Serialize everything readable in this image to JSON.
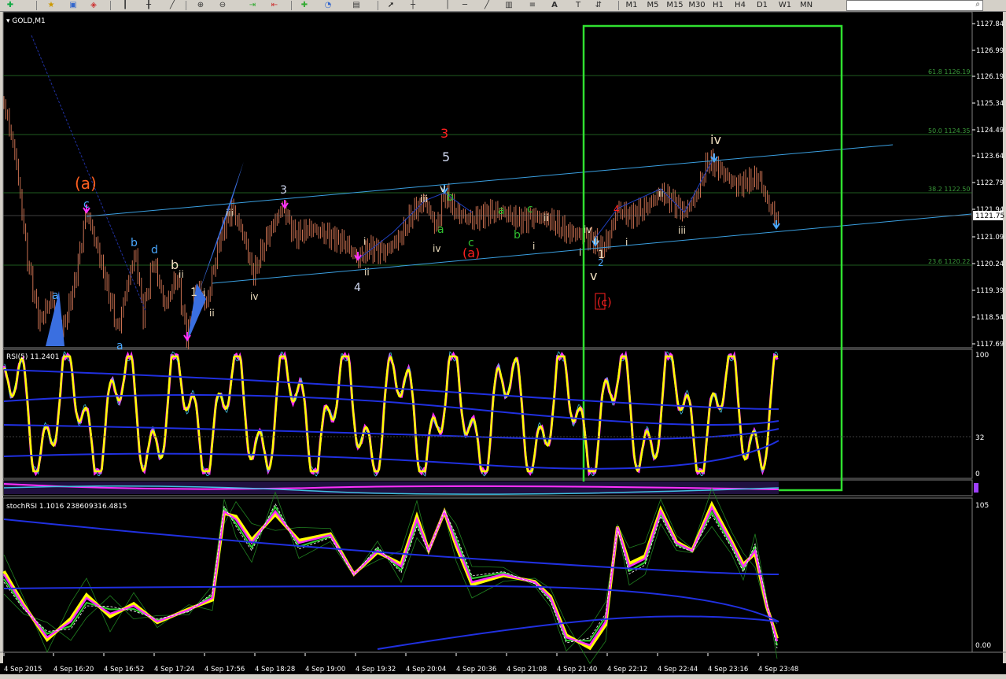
{
  "toolbar": {
    "timeframes": [
      "M1",
      "M5",
      "M15",
      "M30",
      "H1",
      "H4",
      "D1",
      "W1",
      "MN"
    ],
    "search_placeholder": ""
  },
  "chart": {
    "symbol_label": "▾ GOLD,M1",
    "rsi_label": "RSI(5) 11.2401",
    "stochrsi_label": "stochRSI 1.1016 238609316.4815",
    "current_price": "1121.75",
    "rsi_scale": [
      "100",
      "32",
      "0"
    ],
    "stoch_scale": [
      "105",
      "0.00"
    ],
    "price_axis": [
      "1127.84",
      "1126.99",
      "1126.19",
      "1125.34",
      "1124.49",
      "1123.64",
      "1122.79",
      "1121.94",
      "1121.09",
      "1120.24",
      "1119.39",
      "1118.54",
      "1117.69"
    ],
    "fib_levels": [
      {
        "label": "61.8 1126.19"
      },
      {
        "label": "50.0 1124.35"
      },
      {
        "label": "38.2 1122.50"
      },
      {
        "label": "23.6 1120.22"
      }
    ],
    "time_axis": [
      "4 Sep 2015",
      "4 Sep 16:20",
      "4 Sep 16:52",
      "4 Sep 17:24",
      "4 Sep 17:56",
      "4 Sep 18:28",
      "4 Sep 19:00",
      "4 Sep 19:32",
      "4 Sep 20:04",
      "4 Sep 20:36",
      "4 Sep 21:08",
      "4 Sep 21:40",
      "4 Sep 22:12",
      "4 Sep 22:44",
      "4 Sep 23:16",
      "4 Sep 23:48"
    ],
    "wave_labels": [
      {
        "text": "(a)",
        "color": "#ff6020"
      },
      {
        "text": "c",
        "color": "#4aa8ff"
      },
      {
        "text": "a",
        "color": "#4aa8ff"
      },
      {
        "text": "b",
        "color": "#4aa8ff"
      },
      {
        "text": "d",
        "color": "#4aa8ff"
      },
      {
        "text": "a",
        "color": "#4aa8ff"
      },
      {
        "text": "b",
        "color": "#f0e0c0"
      },
      {
        "text": "ii",
        "color": "#f0e0c0"
      },
      {
        "text": "1",
        "color": "#f0e0c0"
      },
      {
        "text": "i",
        "color": "#f0e0c0"
      },
      {
        "text": "ii",
        "color": "#f0e0c0"
      },
      {
        "text": "iii",
        "color": "#f0e0c0"
      },
      {
        "text": "3",
        "color": "#d0d8f0"
      },
      {
        "text": "iv",
        "color": "#f0e0c0"
      },
      {
        "text": "i",
        "color": "#f0e0c0"
      },
      {
        "text": "4",
        "color": "#d0d8f0"
      },
      {
        "text": "ii",
        "color": "#f0e0c0"
      },
      {
        "text": "3",
        "color": "#ff2020"
      },
      {
        "text": "5",
        "color": "#d0d8f0"
      },
      {
        "text": "iii",
        "color": "#f0e0c0"
      },
      {
        "text": "v",
        "color": "#f0e0c0"
      },
      {
        "text": "b",
        "color": "#30c030"
      },
      {
        "text": "a",
        "color": "#30c030"
      },
      {
        "text": "iv",
        "color": "#f0e0c0"
      },
      {
        "text": "c",
        "color": "#30c030"
      },
      {
        "text": "(a)",
        "color": "#ff2020"
      },
      {
        "text": "a",
        "color": "#30c030"
      },
      {
        "text": "b",
        "color": "#30c030"
      },
      {
        "text": "c",
        "color": "#30c030"
      },
      {
        "text": "ii",
        "color": "#f0e0c0"
      },
      {
        "text": "i",
        "color": "#f0e0c0"
      },
      {
        "text": "iv",
        "color": "#f0e0c0"
      },
      {
        "text": "i",
        "color": "#f0e0c0"
      },
      {
        "text": "ii",
        "color": "#f0e0c0"
      },
      {
        "text": "1",
        "color": "#f0e0c0"
      },
      {
        "text": "2",
        "color": "#4aa8ff"
      },
      {
        "text": "v",
        "color": "#f0e0c0"
      },
      {
        "text": "(c)",
        "color": "#ff2020"
      },
      {
        "text": "4",
        "color": "#ff2020"
      },
      {
        "text": "i",
        "color": "#f0e0c0"
      },
      {
        "text": "ii",
        "color": "#f0e0c0"
      },
      {
        "text": "iii",
        "color": "#f0e0c0"
      },
      {
        "text": "iv",
        "color": "#f0e0c0"
      },
      {
        "text": "3",
        "color": "#d0d8f0"
      }
    ],
    "colors": {
      "background": "#000000",
      "candle": "#c87050",
      "channel": "#3a9fe0",
      "fib": "#2a7a2a",
      "highlight_box": "#30e030",
      "rsi_main": "#ffff00",
      "rsi_signal": "#ff30ff",
      "band": "#2030e0"
    }
  }
}
